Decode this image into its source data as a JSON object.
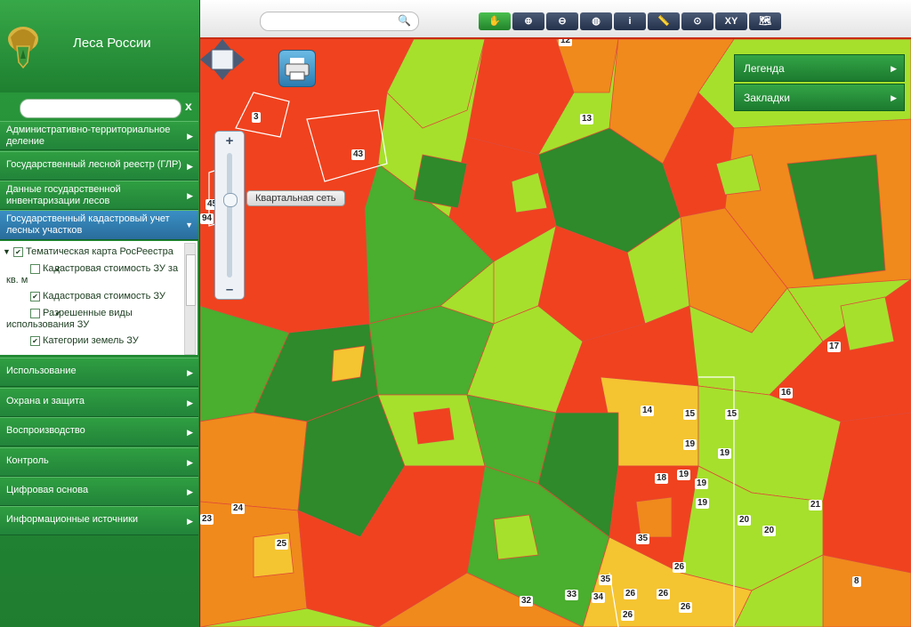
{
  "brand": "Леса России",
  "sidebar": {
    "clear_label": "x",
    "items": [
      {
        "label": "Административно-территориальное деление"
      },
      {
        "label": "Государственный лесной реестр (ГЛР)"
      },
      {
        "label": "Данные государственной инвентаризации лесов"
      },
      {
        "label": "Государственный кадастровый учет лесных участков"
      },
      {
        "label": "Использование"
      },
      {
        "label": "Охрана и защита"
      },
      {
        "label": "Воспроизводство"
      },
      {
        "label": "Контроль"
      },
      {
        "label": "Цифровая основа"
      },
      {
        "label": "Информационные источники"
      }
    ],
    "tree": [
      {
        "label": "Тематическая карта РосРеестра"
      },
      {
        "label": "Кадастровая стоимость ЗУ за кв. м"
      },
      {
        "label": "Кадастровая стоимость ЗУ"
      },
      {
        "label": "Разрешенные виды использования ЗУ"
      },
      {
        "label": "Категории земель ЗУ"
      }
    ]
  },
  "toolbar": {
    "tools": [
      {
        "name": "pan-tool",
        "icon": "hand-icon",
        "label": "✋"
      },
      {
        "name": "zoom-in-tool",
        "icon": "zoom-in-icon",
        "label": "⊕"
      },
      {
        "name": "zoom-out-tool",
        "icon": "zoom-out-icon",
        "label": "⊖"
      },
      {
        "name": "globe-tool",
        "icon": "globe-icon",
        "label": "◍"
      },
      {
        "name": "info-tool",
        "icon": "info-icon",
        "label": "i"
      },
      {
        "name": "measure-tool",
        "icon": "ruler-icon",
        "label": "📏"
      },
      {
        "name": "zoom-extent-tool",
        "icon": "magnifier-icon",
        "label": "⊙"
      },
      {
        "name": "xy-tool",
        "icon": "coordinates-icon",
        "label": "XY"
      },
      {
        "name": "search-tool",
        "icon": "map-search-icon",
        "label": "🗺"
      }
    ]
  },
  "map": {
    "zoom_tooltip": "Квартальная сеть",
    "panels": [
      {
        "label": "Легенда"
      },
      {
        "label": "Закладки"
      }
    ],
    "labels": [
      "12",
      "3",
      "13",
      "43",
      "94",
      "45",
      "14",
      "15",
      "15",
      "16",
      "17",
      "19",
      "19",
      "19",
      "18",
      "19",
      "19",
      "20",
      "21",
      "20",
      "24",
      "25",
      "23",
      "35",
      "26",
      "26",
      "8",
      "35",
      "33",
      "34",
      "26",
      "26",
      "32",
      "26"
    ]
  },
  "colors": {
    "red": "#f0421e",
    "orange": "#f08a1c",
    "yellow": "#f5c431",
    "lime": "#a6e02c",
    "green": "#4aae2e",
    "darkgreen": "#2e8a2a"
  }
}
